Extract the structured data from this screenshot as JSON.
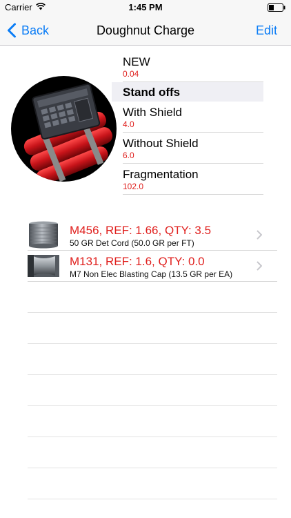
{
  "status_bar": {
    "carrier": "Carrier",
    "time": "1:45 PM"
  },
  "nav_bar": {
    "back_label": "Back",
    "title": "Doughnut Charge",
    "edit_label": "Edit"
  },
  "details": {
    "new": {
      "label": "NEW",
      "value": "0.04"
    },
    "section_header": "Stand offs",
    "with_shield": {
      "label": "With Shield",
      "value": "4.0"
    },
    "without_shield": {
      "label": "Without Shield",
      "value": "6.0"
    },
    "fragmentation": {
      "label": "Fragmentation",
      "value": "102.0"
    }
  },
  "components": [
    {
      "title": "M456, REF: 1.66, QTY: 3.5",
      "subtitle": "50 GR Det Cord (50.0 GR per FT)",
      "icon": "det-cord-spool-icon"
    },
    {
      "title": "M131, REF: 1.6, QTY: 0.0",
      "subtitle": "M7 Non Elec Blasting Cap (13.5 GR per EA)",
      "icon": "blasting-cap-icon"
    }
  ],
  "colors": {
    "accent": "#0a7cf6",
    "value_red": "#e0201e",
    "bar_background": "#f7f7f7",
    "section_header_background": "#efeff4"
  }
}
